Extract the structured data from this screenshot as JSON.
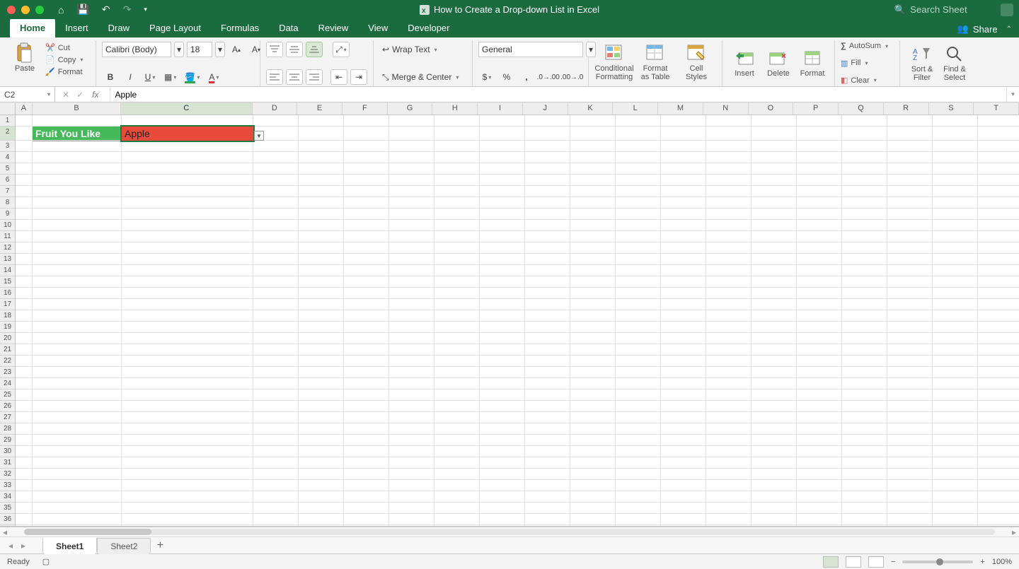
{
  "titlebar": {
    "title": "How to Create a Drop-down List in Excel",
    "search_placeholder": "Search Sheet"
  },
  "tabs": {
    "items": [
      "Home",
      "Insert",
      "Draw",
      "Page Layout",
      "Formulas",
      "Data",
      "Review",
      "View",
      "Developer"
    ],
    "active": "Home",
    "share": "Share"
  },
  "ribbon": {
    "paste": "Paste",
    "cut": "Cut",
    "copy": "Copy",
    "format_painter": "Format",
    "font_name": "Calibri (Body)",
    "font_size": "18",
    "wrap": "Wrap Text",
    "merge": "Merge & Center",
    "number_format": "General",
    "cond_fmt": "Conditional\nFormatting",
    "fmt_table": "Format\nas Table",
    "cell_styles": "Cell\nStyles",
    "insert": "Insert",
    "delete": "Delete",
    "format": "Format",
    "autosum": "AutoSum",
    "fill": "Fill",
    "clear": "Clear",
    "sort": "Sort &\nFilter",
    "find": "Find &\nSelect"
  },
  "formula_bar": {
    "name_box": "C2",
    "formula": "Apple"
  },
  "grid": {
    "columns": [
      "A",
      "B",
      "C",
      "D",
      "E",
      "F",
      "G",
      "H",
      "I",
      "J",
      "K",
      "L",
      "M",
      "N",
      "O",
      "P",
      "Q",
      "R",
      "S",
      "T"
    ],
    "col_widths": {
      "A": 24,
      "B": 126,
      "C": 186,
      "default": 64
    },
    "row_count": 36,
    "tall_row": 2,
    "selected_col": "C",
    "selected_row": 2,
    "b2": "Fruit You Like",
    "c2": "Apple"
  },
  "sheets": {
    "tabs": [
      "Sheet1",
      "Sheet2"
    ],
    "active": "Sheet1"
  },
  "status": {
    "ready": "Ready",
    "zoom": "100%"
  }
}
